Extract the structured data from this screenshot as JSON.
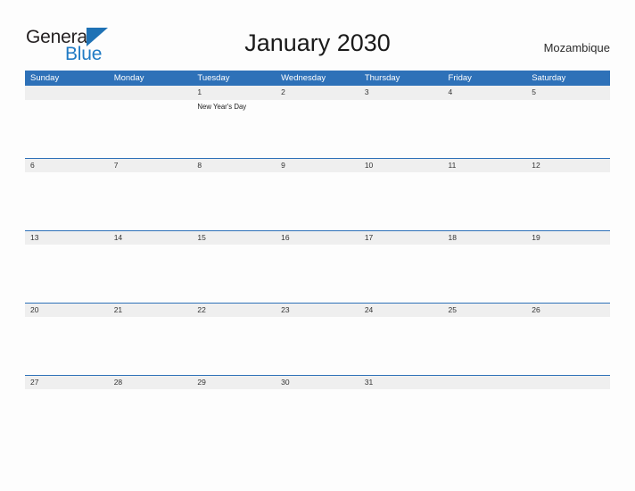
{
  "brand": {
    "name_part1": "General",
    "name_part2": "Blue",
    "accent_color": "#1f72b5"
  },
  "header": {
    "title": "January 2030",
    "country": "Mozambique"
  },
  "theme": {
    "header_blue": "#2e71b8",
    "date_band_gray": "#efefef",
    "page_background": "#fdfdfd"
  },
  "calendar": {
    "day_headers": [
      "Sunday",
      "Monday",
      "Tuesday",
      "Wednesday",
      "Thursday",
      "Friday",
      "Saturday"
    ],
    "weeks": [
      {
        "days": [
          {
            "num": "",
            "event": ""
          },
          {
            "num": "",
            "event": ""
          },
          {
            "num": "1",
            "event": "New Year's Day"
          },
          {
            "num": "2",
            "event": ""
          },
          {
            "num": "3",
            "event": ""
          },
          {
            "num": "4",
            "event": ""
          },
          {
            "num": "5",
            "event": ""
          }
        ]
      },
      {
        "days": [
          {
            "num": "6",
            "event": ""
          },
          {
            "num": "7",
            "event": ""
          },
          {
            "num": "8",
            "event": ""
          },
          {
            "num": "9",
            "event": ""
          },
          {
            "num": "10",
            "event": ""
          },
          {
            "num": "11",
            "event": ""
          },
          {
            "num": "12",
            "event": ""
          }
        ]
      },
      {
        "days": [
          {
            "num": "13",
            "event": ""
          },
          {
            "num": "14",
            "event": ""
          },
          {
            "num": "15",
            "event": ""
          },
          {
            "num": "16",
            "event": ""
          },
          {
            "num": "17",
            "event": ""
          },
          {
            "num": "18",
            "event": ""
          },
          {
            "num": "19",
            "event": ""
          }
        ]
      },
      {
        "days": [
          {
            "num": "20",
            "event": ""
          },
          {
            "num": "21",
            "event": ""
          },
          {
            "num": "22",
            "event": ""
          },
          {
            "num": "23",
            "event": ""
          },
          {
            "num": "24",
            "event": ""
          },
          {
            "num": "25",
            "event": ""
          },
          {
            "num": "26",
            "event": ""
          }
        ]
      },
      {
        "days": [
          {
            "num": "27",
            "event": ""
          },
          {
            "num": "28",
            "event": ""
          },
          {
            "num": "29",
            "event": ""
          },
          {
            "num": "30",
            "event": ""
          },
          {
            "num": "31",
            "event": ""
          },
          {
            "num": "",
            "event": ""
          },
          {
            "num": "",
            "event": ""
          }
        ]
      }
    ]
  }
}
